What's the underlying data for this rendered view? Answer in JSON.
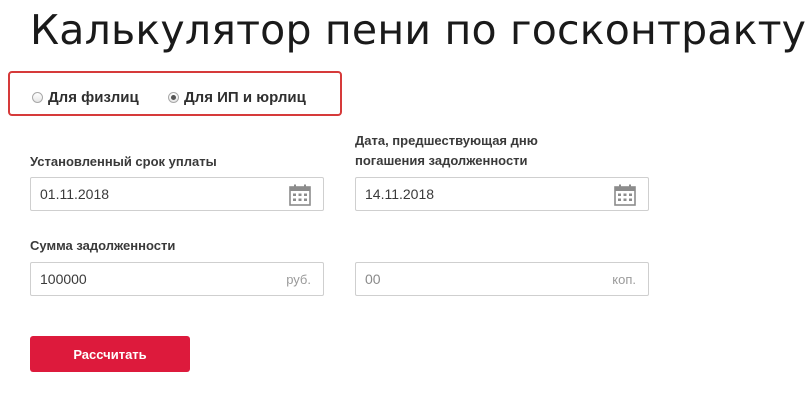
{
  "page": {
    "title": "Калькулятор пени по госконтракту"
  },
  "person_type": {
    "options": [
      {
        "label": "Для физлиц",
        "checked": false
      },
      {
        "label": "Для ИП и юрлиц",
        "checked": true
      }
    ]
  },
  "form": {
    "due_date": {
      "label": "Установленный срок уплаты",
      "value": "01.11.2018",
      "icon": "calendar-icon"
    },
    "payment_date": {
      "label_line1": "Дата, предшествующая дню",
      "label_line2": "погашения задолженности",
      "value": "14.11.2018",
      "icon": "calendar-icon"
    },
    "debt_amount": {
      "label": "Сумма задолженности",
      "rubles_value": "100000",
      "rubles_suffix": "руб.",
      "kopecks_placeholder": "00",
      "kopecks_suffix": "коп."
    },
    "submit_label": "Рассчитать"
  },
  "colors": {
    "accent": "#dd1a3c",
    "highlight_border": "#d63a3a"
  }
}
